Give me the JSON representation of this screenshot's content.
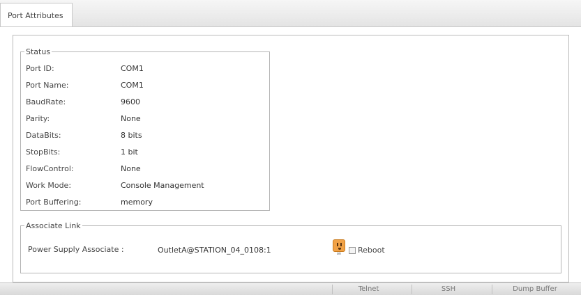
{
  "tabs": [
    {
      "label": "Port Attributes"
    }
  ],
  "status": {
    "legend": "Status",
    "rows": [
      {
        "label": "Port ID:",
        "value": "COM1"
      },
      {
        "label": "Port Name:",
        "value": "COM1"
      },
      {
        "label": "BaudRate:",
        "value": "9600"
      },
      {
        "label": "Parity:",
        "value": "None"
      },
      {
        "label": "DataBits:",
        "value": "8 bits"
      },
      {
        "label": "StopBits:",
        "value": "1 bit"
      },
      {
        "label": "FlowControl:",
        "value": "None"
      },
      {
        "label": "Work Mode:",
        "value": "Console Management"
      },
      {
        "label": "Port Buffering:",
        "value": "memory"
      }
    ]
  },
  "associate": {
    "legend": "Associate Link",
    "power_label": "Power Supply Associate :",
    "power_value": "OutletA@STATION_04_0108:1",
    "outlet_icon": "outlet-icon",
    "outlet_tag": "on",
    "reboot_label": "Reboot",
    "reboot_checked": false
  },
  "footer": {
    "buttons": [
      {
        "label": "Telnet"
      },
      {
        "label": "SSH"
      },
      {
        "label": "Dump Buffer"
      }
    ]
  },
  "colors": {
    "outlet": "#f1a247",
    "border": "#b9b9b9"
  }
}
